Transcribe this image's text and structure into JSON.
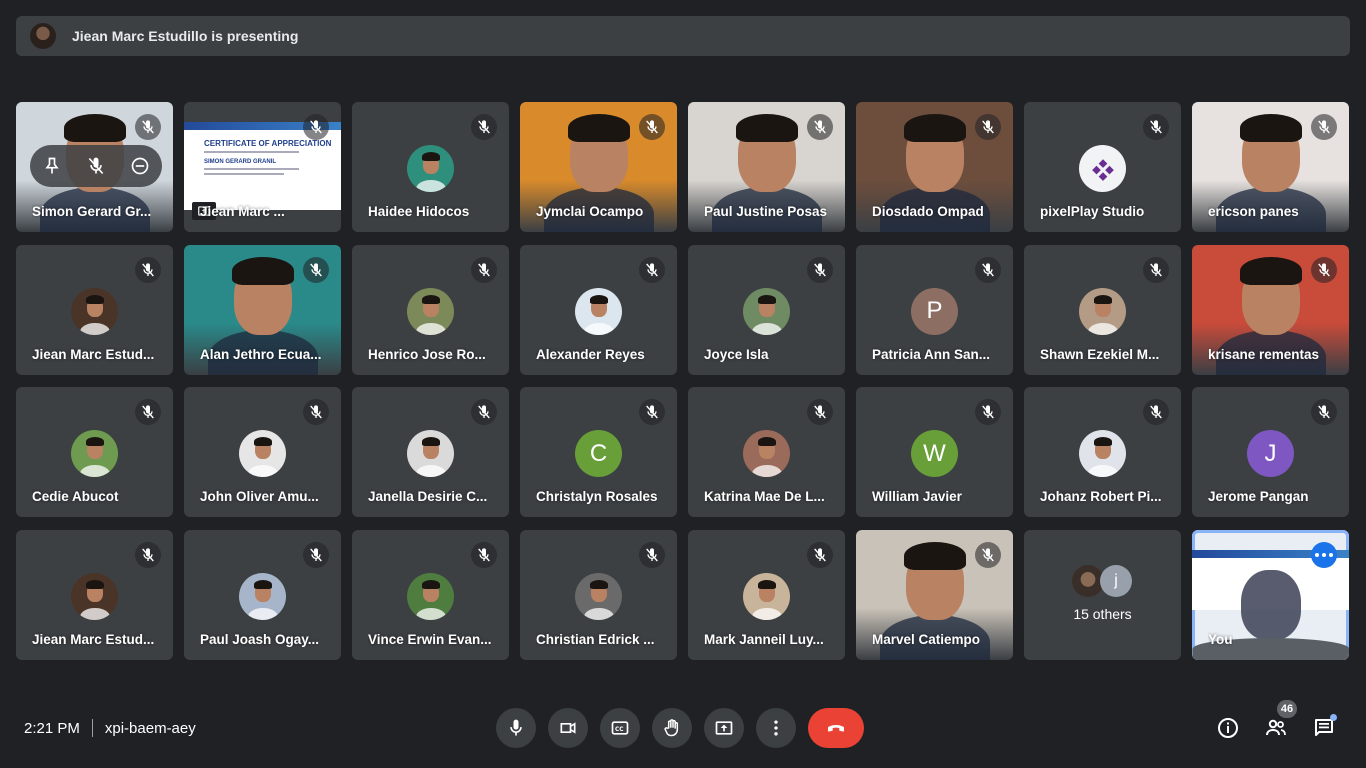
{
  "banner": {
    "text": "Jiean Marc Estudillo is presenting"
  },
  "tiles": [
    {
      "name": "Simon Gerard Gr...",
      "type": "video",
      "bg": "#cfd6dc"
    },
    {
      "name": "Jiean Marc ...",
      "type": "slide",
      "slide_title": "CERTIFICATE OF APPRECIATION",
      "slide_name": "SIMON GERARD GRANIL"
    },
    {
      "name": "Haidee Hidocos",
      "type": "avatar",
      "bg": "#2f8f7d"
    },
    {
      "name": "Jymclai Ocampo",
      "type": "video",
      "bg": "#d98b2b"
    },
    {
      "name": "Paul Justine Posas",
      "type": "video",
      "bg": "#d8d4cf"
    },
    {
      "name": "Diosdado Ompad",
      "type": "video",
      "bg": "#6d4e3c"
    },
    {
      "name": "pixelPlay Studio",
      "type": "logo",
      "bg": "#f1f3f4"
    },
    {
      "name": "ericson panes",
      "type": "video",
      "bg": "#e7e2df"
    },
    {
      "name": "Jiean Marc Estud...",
      "type": "avatar",
      "bg": "#4a3428"
    },
    {
      "name": "Alan Jethro Ecua...",
      "type": "video",
      "bg": "#2a8a8a"
    },
    {
      "name": "Henrico Jose Ro...",
      "type": "avatar",
      "bg": "#7c8a5a"
    },
    {
      "name": "Alexander Reyes",
      "type": "avatar",
      "bg": "#dce6ee"
    },
    {
      "name": "Joyce Isla",
      "type": "avatar",
      "bg": "#6f8b63"
    },
    {
      "name": "Patricia Ann San...",
      "type": "letter",
      "letter": "P",
      "bg": "#8d6e63"
    },
    {
      "name": "Shawn Ezekiel M...",
      "type": "avatar",
      "bg": "#b49b86"
    },
    {
      "name": "krisane rementas",
      "type": "video",
      "bg": "#c94b3a"
    },
    {
      "name": "Cedie Abucot",
      "type": "avatar",
      "bg": "#6e9b4f"
    },
    {
      "name": "John Oliver Amu...",
      "type": "avatar",
      "bg": "#e6e6e6"
    },
    {
      "name": "Janella Desirie C...",
      "type": "avatar",
      "bg": "#dadada"
    },
    {
      "name": "Christalyn Rosales",
      "type": "letter",
      "letter": "C",
      "bg": "#689f38"
    },
    {
      "name": "Katrina Mae De L...",
      "type": "avatar",
      "bg": "#9a6a5a"
    },
    {
      "name": "William Javier",
      "type": "letter",
      "letter": "W",
      "bg": "#689f38"
    },
    {
      "name": "Johanz Robert Pi...",
      "type": "avatar",
      "bg": "#e0e4ea"
    },
    {
      "name": "Jerome Pangan",
      "type": "letter",
      "letter": "J",
      "bg": "#7e57c2"
    },
    {
      "name": "Jiean Marc Estud...",
      "type": "avatar",
      "bg": "#4a3428"
    },
    {
      "name": "Paul Joash Ogay...",
      "type": "avatar",
      "bg": "#a6b5c9"
    },
    {
      "name": "Vince Erwin Evan...",
      "type": "avatar",
      "bg": "#4f7c3f"
    },
    {
      "name": "Christian Edrick ...",
      "type": "avatar",
      "bg": "#6a6a6a"
    },
    {
      "name": "Mark Janneil Luy...",
      "type": "avatar",
      "bg": "#c8b49a"
    },
    {
      "name": "Marvel Catiempo",
      "type": "video",
      "bg": "#c9c2b8"
    },
    {
      "name": "15 others",
      "type": "others",
      "second_initial": "j"
    },
    {
      "name": "You",
      "type": "you"
    }
  ],
  "meeting": {
    "time": "2:21 PM",
    "code": "xpi-baem-aey"
  },
  "controls": [
    "mic-icon",
    "camera-icon",
    "captions-icon",
    "raise-hand-icon",
    "present-icon",
    "more-options-icon",
    "hang-up-icon"
  ],
  "people_count": "46",
  "colors": {
    "background": "#202124",
    "tile": "#3c4043",
    "hangup": "#ea4335",
    "accent": "#8ab4f8"
  }
}
